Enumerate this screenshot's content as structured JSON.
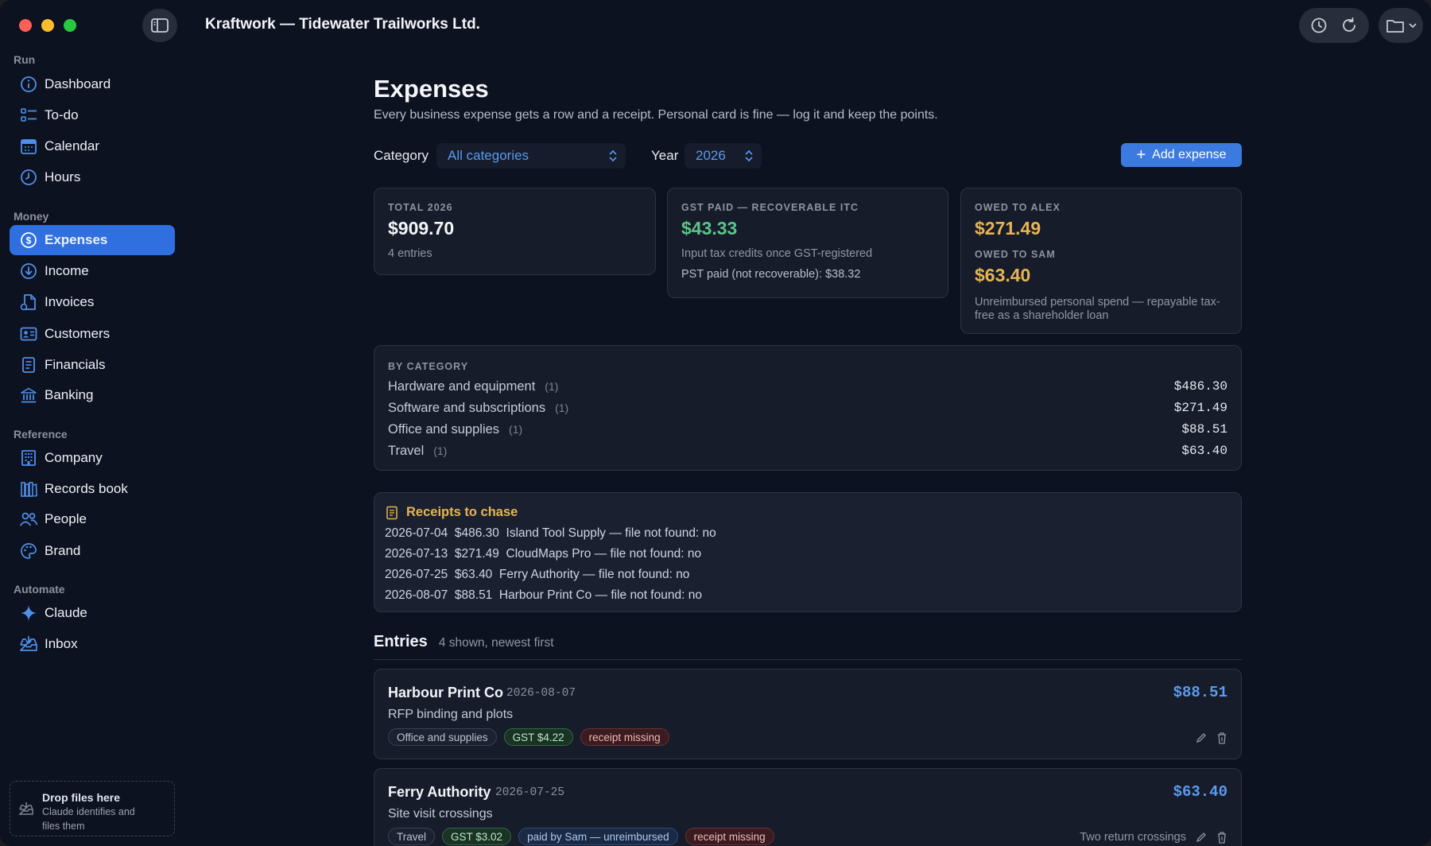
{
  "window": {
    "title": "Kraftwork — Tidewater Trailworks Ltd."
  },
  "sidebar": {
    "sections": [
      {
        "label": "Run"
      },
      {
        "label": "Money"
      },
      {
        "label": "Reference"
      },
      {
        "label": "Automate"
      }
    ],
    "items": [
      {
        "label": "Dashboard",
        "icon": "dashboard-icon"
      },
      {
        "label": "To-do",
        "icon": "todo-list-icon"
      },
      {
        "label": "Calendar",
        "icon": "calendar-icon"
      },
      {
        "label": "Hours",
        "icon": "clock-icon"
      },
      {
        "label": "Expenses",
        "icon": "dollar-icon",
        "active": true
      },
      {
        "label": "Income",
        "icon": "arrow-down-circle-icon"
      },
      {
        "label": "Invoices",
        "icon": "invoice-icon"
      },
      {
        "label": "Customers",
        "icon": "contact-card-icon"
      },
      {
        "label": "Financials",
        "icon": "document-icon"
      },
      {
        "label": "Banking",
        "icon": "bank-icon"
      },
      {
        "label": "Company",
        "icon": "building-icon"
      },
      {
        "label": "Records book",
        "icon": "books-icon"
      },
      {
        "label": "People",
        "icon": "people-icon"
      },
      {
        "label": "Brand",
        "icon": "palette-icon"
      },
      {
        "label": "Claude",
        "icon": "sparkle-icon"
      },
      {
        "label": "Inbox",
        "icon": "inbox-icon"
      }
    ],
    "drop_zone": {
      "title": "Drop files here",
      "subtitle_1": "Claude identifies and",
      "subtitle_2": "files them"
    }
  },
  "page": {
    "title": "Expenses",
    "subtitle": "Every business expense gets a row and a receipt. Personal card is fine — log it and keep the points.",
    "filters": {
      "category_label": "Category",
      "category_value": "All categories",
      "year_label": "Year",
      "year_value": "2026"
    },
    "add_button": "Add expense"
  },
  "summary": {
    "total": {
      "caption": "TOTAL 2026",
      "value": "$909.70",
      "note": "4 entries"
    },
    "gst": {
      "caption": "GST PAID — RECOVERABLE ITC",
      "value": "$43.33",
      "note": "Input tax credits once GST-registered",
      "pst": "PST paid (not recoverable): $38.32"
    },
    "owed": {
      "alex_caption": "OWED TO ALEX",
      "alex_value": "$271.49",
      "sam_caption": "OWED TO SAM",
      "sam_value": "$63.40",
      "note_1": "Unreimbursed personal spend — repayable tax-",
      "note_2": "free as a shareholder loan"
    }
  },
  "by_category": {
    "caption": "BY CATEGORY",
    "rows": [
      {
        "name": "Hardware and equipment",
        "count": "(1)",
        "amount": "$486.30"
      },
      {
        "name": "Software and subscriptions",
        "count": "(1)",
        "amount": "$271.49"
      },
      {
        "name": "Office and supplies",
        "count": "(1)",
        "amount": "$88.51"
      },
      {
        "name": "Travel",
        "count": "(1)",
        "amount": "$63.40"
      }
    ]
  },
  "receipts": {
    "title": "Receipts to chase",
    "lines": [
      "2026-07-04  $486.30  Island Tool Supply — file not found: no",
      "2026-07-13  $271.49  CloudMaps Pro — file not found: no",
      "2026-07-25  $63.40  Ferry Authority — file not found: no",
      "2026-08-07  $88.51  Harbour Print Co — file not found: no"
    ]
  },
  "entries": {
    "title": "Entries",
    "count": "4 shown, newest first",
    "items": [
      {
        "vendor": "Harbour Print Co",
        "date": "2026-08-07",
        "amount": "$88.51",
        "description": "RFP binding and plots",
        "category": "Office and supplies",
        "gst": "GST $4.22",
        "receipt": "receipt missing",
        "note": ""
      },
      {
        "vendor": "Ferry Authority",
        "date": "2026-07-25",
        "amount": "$63.40",
        "description": "Site visit crossings",
        "category": "Travel",
        "gst": "GST $3.02",
        "paid_by": "paid by Sam — unreimbursed",
        "receipt": "receipt missing",
        "note": "Two return crossings"
      }
    ]
  },
  "colors": {
    "accent": "#3b7be0",
    "background": "#0d1220",
    "card": "#161c2a",
    "green": "#5cc489",
    "amber": "#e9b451"
  }
}
